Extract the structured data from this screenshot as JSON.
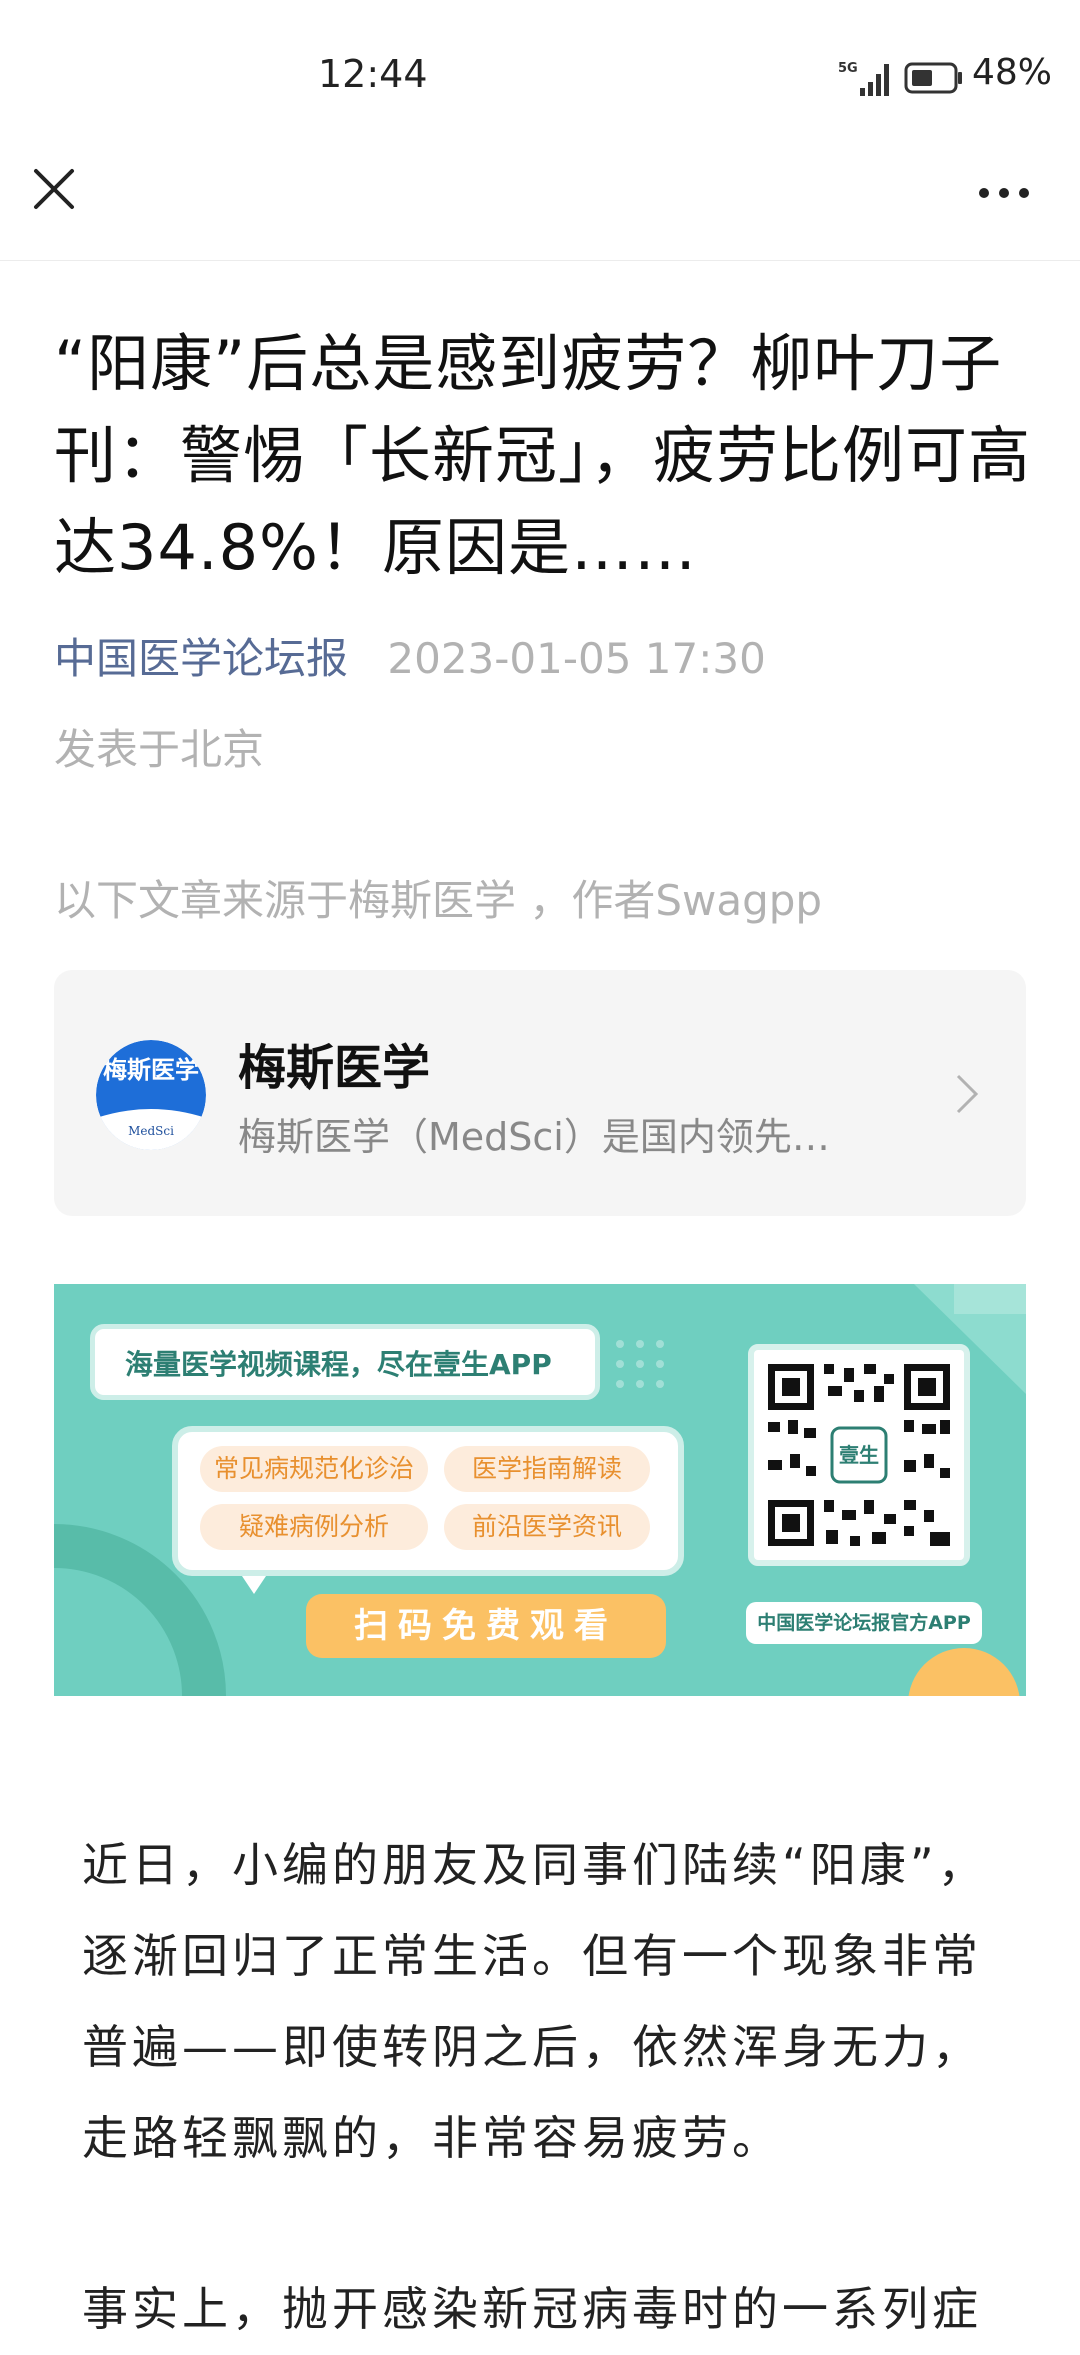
{
  "status_bar": {
    "time": "12:44",
    "network": "5G",
    "battery": "48%"
  },
  "article": {
    "title": "“阳康”后总是感到疲劳？柳叶刀子刊：警惕「长新冠」，疲劳比例可高达34.8%！原因是……",
    "source": "中国医学论坛报",
    "date": "2023-01-05 17:30",
    "location": "发表于北京",
    "origin_note": "以下文章来源于梅斯医学 ，作者Swagpp"
  },
  "source_card": {
    "avatar_text": "梅斯医学",
    "avatar_sub": "MedSci",
    "name": "梅斯医学",
    "description": "梅斯医学（MedSci）是国内领先…"
  },
  "banner": {
    "headline": "海量医学视频课程，尽在壹生APP",
    "tags": [
      "常见病规范化诊治",
      "医学指南解读",
      "疑难病例分析",
      "前沿医学资讯"
    ],
    "cta": "扫码免费观看",
    "qr_center": "壹生",
    "qr_label": "中国医学论坛报官方APP",
    "colors": {
      "background": "#6fcfc0",
      "accent": "#fbc164",
      "tag_text": "#e8902f"
    }
  },
  "body": {
    "paragraph_1": "近日，小编的朋友及同事们陆续“阳康”，逐渐回归了正常生活。但有一个现象非常普遍——即使转阴之后，依然浑身无力，走路轻飘飘的，非常容易疲劳。",
    "paragraph_2": "事实上，抛开感染新冠病毒时的一系列症"
  },
  "icons": {
    "close": "close-icon",
    "more": "more-icon",
    "chevron": "chevron-right-icon"
  }
}
